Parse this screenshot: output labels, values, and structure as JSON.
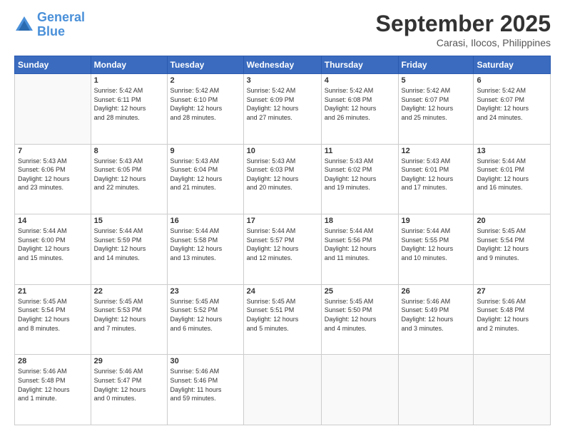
{
  "header": {
    "logo_line1": "General",
    "logo_line2": "Blue",
    "month": "September 2025",
    "location": "Carasi, Ilocos, Philippines"
  },
  "days_of_week": [
    "Sunday",
    "Monday",
    "Tuesday",
    "Wednesday",
    "Thursday",
    "Friday",
    "Saturday"
  ],
  "weeks": [
    [
      {
        "num": "",
        "info": ""
      },
      {
        "num": "1",
        "info": "Sunrise: 5:42 AM\nSunset: 6:11 PM\nDaylight: 12 hours\nand 28 minutes."
      },
      {
        "num": "2",
        "info": "Sunrise: 5:42 AM\nSunset: 6:10 PM\nDaylight: 12 hours\nand 28 minutes."
      },
      {
        "num": "3",
        "info": "Sunrise: 5:42 AM\nSunset: 6:09 PM\nDaylight: 12 hours\nand 27 minutes."
      },
      {
        "num": "4",
        "info": "Sunrise: 5:42 AM\nSunset: 6:08 PM\nDaylight: 12 hours\nand 26 minutes."
      },
      {
        "num": "5",
        "info": "Sunrise: 5:42 AM\nSunset: 6:07 PM\nDaylight: 12 hours\nand 25 minutes."
      },
      {
        "num": "6",
        "info": "Sunrise: 5:42 AM\nSunset: 6:07 PM\nDaylight: 12 hours\nand 24 minutes."
      }
    ],
    [
      {
        "num": "7",
        "info": "Sunrise: 5:43 AM\nSunset: 6:06 PM\nDaylight: 12 hours\nand 23 minutes."
      },
      {
        "num": "8",
        "info": "Sunrise: 5:43 AM\nSunset: 6:05 PM\nDaylight: 12 hours\nand 22 minutes."
      },
      {
        "num": "9",
        "info": "Sunrise: 5:43 AM\nSunset: 6:04 PM\nDaylight: 12 hours\nand 21 minutes."
      },
      {
        "num": "10",
        "info": "Sunrise: 5:43 AM\nSunset: 6:03 PM\nDaylight: 12 hours\nand 20 minutes."
      },
      {
        "num": "11",
        "info": "Sunrise: 5:43 AM\nSunset: 6:02 PM\nDaylight: 12 hours\nand 19 minutes."
      },
      {
        "num": "12",
        "info": "Sunrise: 5:43 AM\nSunset: 6:01 PM\nDaylight: 12 hours\nand 17 minutes."
      },
      {
        "num": "13",
        "info": "Sunrise: 5:44 AM\nSunset: 6:01 PM\nDaylight: 12 hours\nand 16 minutes."
      }
    ],
    [
      {
        "num": "14",
        "info": "Sunrise: 5:44 AM\nSunset: 6:00 PM\nDaylight: 12 hours\nand 15 minutes."
      },
      {
        "num": "15",
        "info": "Sunrise: 5:44 AM\nSunset: 5:59 PM\nDaylight: 12 hours\nand 14 minutes."
      },
      {
        "num": "16",
        "info": "Sunrise: 5:44 AM\nSunset: 5:58 PM\nDaylight: 12 hours\nand 13 minutes."
      },
      {
        "num": "17",
        "info": "Sunrise: 5:44 AM\nSunset: 5:57 PM\nDaylight: 12 hours\nand 12 minutes."
      },
      {
        "num": "18",
        "info": "Sunrise: 5:44 AM\nSunset: 5:56 PM\nDaylight: 12 hours\nand 11 minutes."
      },
      {
        "num": "19",
        "info": "Sunrise: 5:44 AM\nSunset: 5:55 PM\nDaylight: 12 hours\nand 10 minutes."
      },
      {
        "num": "20",
        "info": "Sunrise: 5:45 AM\nSunset: 5:54 PM\nDaylight: 12 hours\nand 9 minutes."
      }
    ],
    [
      {
        "num": "21",
        "info": "Sunrise: 5:45 AM\nSunset: 5:54 PM\nDaylight: 12 hours\nand 8 minutes."
      },
      {
        "num": "22",
        "info": "Sunrise: 5:45 AM\nSunset: 5:53 PM\nDaylight: 12 hours\nand 7 minutes."
      },
      {
        "num": "23",
        "info": "Sunrise: 5:45 AM\nSunset: 5:52 PM\nDaylight: 12 hours\nand 6 minutes."
      },
      {
        "num": "24",
        "info": "Sunrise: 5:45 AM\nSunset: 5:51 PM\nDaylight: 12 hours\nand 5 minutes."
      },
      {
        "num": "25",
        "info": "Sunrise: 5:45 AM\nSunset: 5:50 PM\nDaylight: 12 hours\nand 4 minutes."
      },
      {
        "num": "26",
        "info": "Sunrise: 5:46 AM\nSunset: 5:49 PM\nDaylight: 12 hours\nand 3 minutes."
      },
      {
        "num": "27",
        "info": "Sunrise: 5:46 AM\nSunset: 5:48 PM\nDaylight: 12 hours\nand 2 minutes."
      }
    ],
    [
      {
        "num": "28",
        "info": "Sunrise: 5:46 AM\nSunset: 5:48 PM\nDaylight: 12 hours\nand 1 minute."
      },
      {
        "num": "29",
        "info": "Sunrise: 5:46 AM\nSunset: 5:47 PM\nDaylight: 12 hours\nand 0 minutes."
      },
      {
        "num": "30",
        "info": "Sunrise: 5:46 AM\nSunset: 5:46 PM\nDaylight: 11 hours\nand 59 minutes."
      },
      {
        "num": "",
        "info": ""
      },
      {
        "num": "",
        "info": ""
      },
      {
        "num": "",
        "info": ""
      },
      {
        "num": "",
        "info": ""
      }
    ]
  ]
}
